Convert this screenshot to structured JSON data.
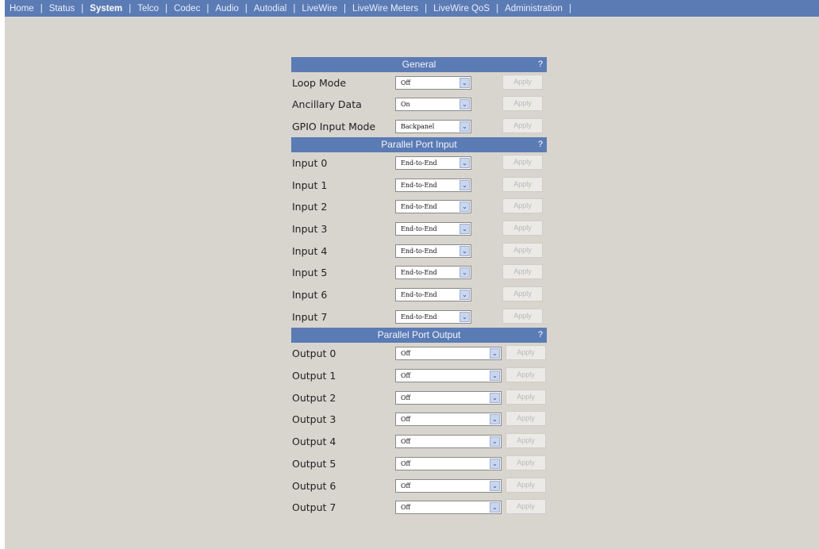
{
  "nav": {
    "items": [
      {
        "label": "Home",
        "active": false
      },
      {
        "label": "Status",
        "active": false
      },
      {
        "label": "System",
        "active": true
      },
      {
        "label": "Telco",
        "active": false
      },
      {
        "label": "Codec",
        "active": false
      },
      {
        "label": "Audio",
        "active": false
      },
      {
        "label": "Autodial",
        "active": false
      },
      {
        "label": "LiveWire",
        "active": false
      },
      {
        "label": "LiveWire Meters",
        "active": false
      },
      {
        "label": "LiveWire QoS",
        "active": false
      },
      {
        "label": "Administration",
        "active": false
      }
    ],
    "separator": "|"
  },
  "help_mark": "?",
  "apply_label": "Apply",
  "select_arrow": "⌄",
  "sections": {
    "general": {
      "title": "General",
      "rows": [
        {
          "label": "Loop Mode",
          "value": "Off"
        },
        {
          "label": "Ancillary Data",
          "value": "On"
        },
        {
          "label": "GPIO Input Mode",
          "value": "Backpanel"
        }
      ]
    },
    "parallel_input": {
      "title": "Parallel Port Input",
      "rows": [
        {
          "label": "Input 0",
          "value": "End-to-End"
        },
        {
          "label": "Input 1",
          "value": "End-to-End"
        },
        {
          "label": "Input 2",
          "value": "End-to-End"
        },
        {
          "label": "Input 3",
          "value": "End-to-End"
        },
        {
          "label": "Input 4",
          "value": "End-to-End"
        },
        {
          "label": "Input 5",
          "value": "End-to-End"
        },
        {
          "label": "Input 6",
          "value": "End-to-End"
        },
        {
          "label": "Input 7",
          "value": "End-to-End"
        }
      ]
    },
    "parallel_output": {
      "title": "Parallel Port Output",
      "rows": [
        {
          "label": "Output 0",
          "value": "Off"
        },
        {
          "label": "Output 1",
          "value": "Off"
        },
        {
          "label": "Output 2",
          "value": "Off"
        },
        {
          "label": "Output 3",
          "value": "Off"
        },
        {
          "label": "Output 4",
          "value": "Off"
        },
        {
          "label": "Output 5",
          "value": "Off"
        },
        {
          "label": "Output 6",
          "value": "Off"
        },
        {
          "label": "Output 7",
          "value": "Off"
        }
      ]
    }
  },
  "colors": {
    "accent": "#5b7bb5",
    "background": "#d8d4ce"
  }
}
